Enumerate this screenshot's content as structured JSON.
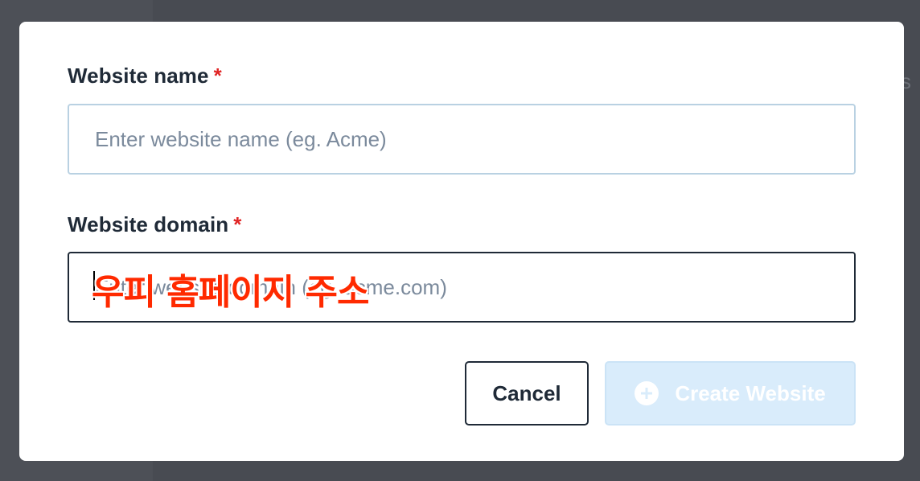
{
  "background": {
    "partial_text": "s"
  },
  "form": {
    "name_field": {
      "label": "Website name",
      "required_mark": "*",
      "placeholder": "Enter website name (eg. Acme)",
      "value": ""
    },
    "domain_field": {
      "label": "Website domain",
      "required_mark": "*",
      "placeholder": "Enter website domain (eg. acme.com)",
      "value": ""
    }
  },
  "overlay": {
    "caption": "우피 홈페이지 주소"
  },
  "buttons": {
    "cancel_label": "Cancel",
    "create_label": "Create Website",
    "create_icon": "plus-circle-icon"
  },
  "colors": {
    "label_text": "#1f2a37",
    "required": "#e02424",
    "input_border": "#b9d1e2",
    "input_border_focused": "#1f2a37",
    "create_button_bg": "#d9ecfb",
    "overlay_caption": "#ff2a00"
  }
}
